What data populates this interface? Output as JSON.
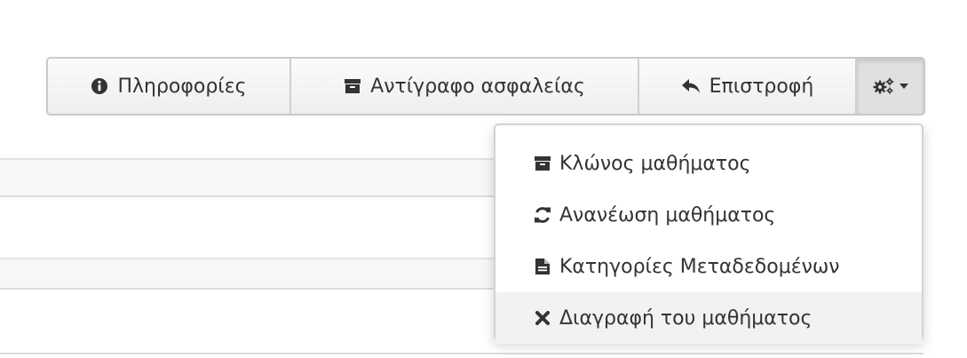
{
  "toolbar": {
    "info_label": "Πληροφορίες",
    "backup_label": "Αντίγραφο ασφαλείας",
    "return_label": "Επιστροφή",
    "info_icon": "info-circle-icon",
    "backup_icon": "archive-icon",
    "return_icon": "reply-icon",
    "settings_icon": "cogs-icon"
  },
  "dropdown": {
    "items": [
      {
        "label": "Κλώνος μαθήματος",
        "icon": "archive-icon"
      },
      {
        "label": "Ανανέωση μαθήματος",
        "icon": "refresh-icon"
      },
      {
        "label": "Κατηγορίες Μεταδεδομένων",
        "icon": "file-text-icon"
      },
      {
        "label": "Διαγραφή του μαθήματος",
        "icon": "times-icon"
      }
    ],
    "highlighted_index": 3
  },
  "colors": {
    "text": "#333333",
    "border": "#c9c9c9",
    "button_bg": "#f3f3f3",
    "active_button_bg": "#e0e0e0",
    "hover_item_bg": "#f2f2f2"
  }
}
